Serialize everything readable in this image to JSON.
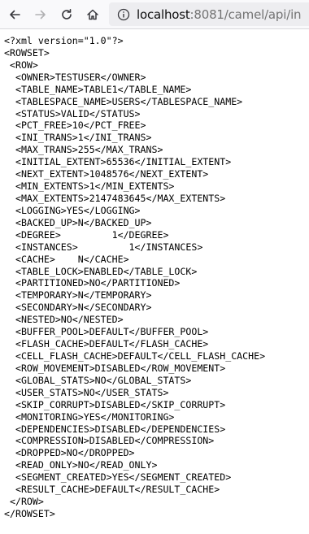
{
  "browser": {
    "url_host": "localhost",
    "url_rest": ":8081/camel/api/in"
  },
  "xml_lines": [
    "<?xml version=\"1.0\"?>",
    "<ROWSET>",
    " <ROW>",
    "  <OWNER>TESTUSER</OWNER>",
    "  <TABLE_NAME>TABLE1</TABLE_NAME>",
    "  <TABLESPACE_NAME>USERS</TABLESPACE_NAME>",
    "  <STATUS>VALID</STATUS>",
    "  <PCT_FREE>10</PCT_FREE>",
    "  <INI_TRANS>1</INI_TRANS>",
    "  <MAX_TRANS>255</MAX_TRANS>",
    "  <INITIAL_EXTENT>65536</INITIAL_EXTENT>",
    "  <NEXT_EXTENT>1048576</NEXT_EXTENT>",
    "  <MIN_EXTENTS>1</MIN_EXTENTS>",
    "  <MAX_EXTENTS>2147483645</MAX_EXTENTS>",
    "  <LOGGING>YES</LOGGING>",
    "  <BACKED_UP>N</BACKED_UP>",
    "  <DEGREE>         1</DEGREE>",
    "  <INSTANCES>         1</INSTANCES>",
    "  <CACHE>    N</CACHE>",
    "  <TABLE_LOCK>ENABLED</TABLE_LOCK>",
    "  <PARTITIONED>NO</PARTITIONED>",
    "  <TEMPORARY>N</TEMPORARY>",
    "  <SECONDARY>N</SECONDARY>",
    "  <NESTED>NO</NESTED>",
    "  <BUFFER_POOL>DEFAULT</BUFFER_POOL>",
    "  <FLASH_CACHE>DEFAULT</FLASH_CACHE>",
    "  <CELL_FLASH_CACHE>DEFAULT</CELL_FLASH_CACHE>",
    "  <ROW_MOVEMENT>DISABLED</ROW_MOVEMENT>",
    "  <GLOBAL_STATS>NO</GLOBAL_STATS>",
    "  <USER_STATS>NO</USER_STATS>",
    "  <SKIP_CORRUPT>DISABLED</SKIP_CORRUPT>",
    "  <MONITORING>YES</MONITORING>",
    "  <DEPENDENCIES>DISABLED</DEPENDENCIES>",
    "  <COMPRESSION>DISABLED</COMPRESSION>",
    "  <DROPPED>NO</DROPPED>",
    "  <READ_ONLY>NO</READ_ONLY>",
    "  <SEGMENT_CREATED>YES</SEGMENT_CREATED>",
    "  <RESULT_CACHE>DEFAULT</RESULT_CACHE>",
    " </ROW>",
    "</ROWSET>"
  ]
}
